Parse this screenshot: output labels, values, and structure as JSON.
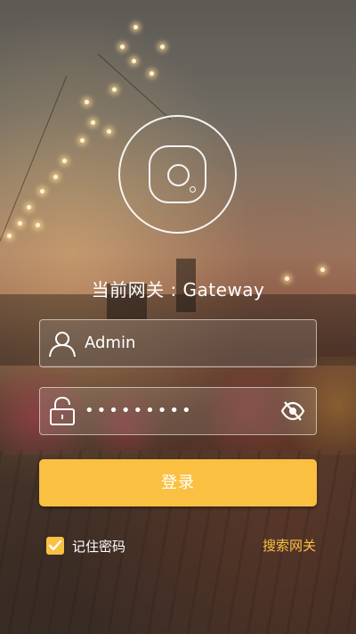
{
  "theme": {
    "accent": "#f9c042",
    "text": "#ffffff"
  },
  "gateway": {
    "title": "当前网关 : Gateway"
  },
  "login_form": {
    "username": {
      "icon": "user-icon",
      "value": "Admin"
    },
    "password": {
      "icon": "lock-icon",
      "masked_value": "•••••••••",
      "visibility_toggle_icon": "eye-off-icon"
    },
    "login_label": "登录",
    "remember_password": {
      "label": "记住密码",
      "checked": true
    },
    "search_gateway_label": "搜索网关"
  }
}
